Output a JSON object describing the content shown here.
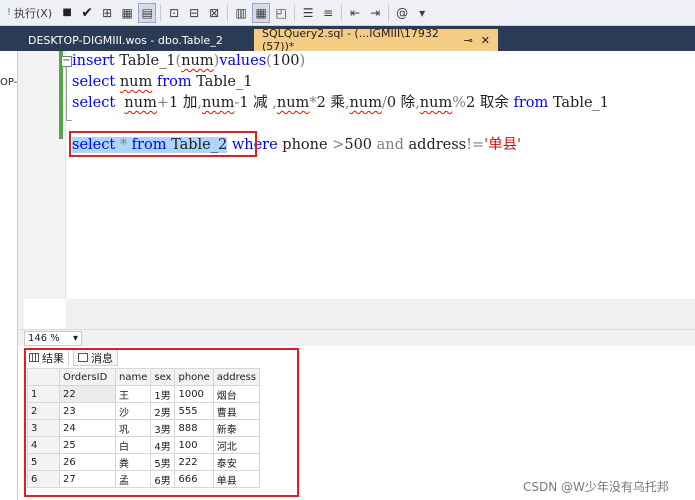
{
  "toolbar": {
    "execute_label": "执行(X)",
    "icons": [
      "dropdown-icon",
      "stop-icon",
      "check-icon",
      "plan-icon",
      "parse-icon",
      "results-to-icon",
      "comment-icon",
      "uncomment-icon",
      "indent-icon",
      "outdent-icon",
      "snippet-icon",
      "more-icon"
    ]
  },
  "tabs": {
    "inactive": "DESKTOP-DIGMIII.wos - dbo.Table_2",
    "active": "SQLQuery2.sql - (...IGMIII\\17932 (57))*",
    "pin": "⊸",
    "close": "✕",
    "left_close": "✕"
  },
  "left_panel": {
    "fragment": "OP-"
  },
  "editor": {
    "lines": [
      {
        "tokens": [
          {
            "t": "insert ",
            "c": "kw"
          },
          {
            "t": "Table_1",
            "c": "plain"
          },
          {
            "t": "(",
            "c": "gray"
          },
          {
            "t": "num",
            "c": "squig"
          },
          {
            "t": ")",
            "c": "gray"
          },
          {
            "t": "values",
            "c": "kw"
          },
          {
            "t": "(",
            "c": "gray"
          },
          {
            "t": "100",
            "c": "plain"
          },
          {
            "t": ")",
            "c": "gray"
          }
        ]
      },
      {
        "tokens": [
          {
            "t": "select ",
            "c": "kw"
          },
          {
            "t": "num",
            "c": "squig"
          },
          {
            "t": " ",
            "c": "plain"
          },
          {
            "t": "from ",
            "c": "kw"
          },
          {
            "t": "Table_1",
            "c": "plain"
          }
        ]
      },
      {
        "tokens": [
          {
            "t": "select  ",
            "c": "kw"
          },
          {
            "t": "num",
            "c": "squig"
          },
          {
            "t": "+",
            "c": "gray"
          },
          {
            "t": "1 加",
            "c": "plain"
          },
          {
            "t": ",",
            "c": "gray"
          },
          {
            "t": "num",
            "c": "squig"
          },
          {
            "t": "-",
            "c": "gray"
          },
          {
            "t": "1 减 ",
            "c": "plain"
          },
          {
            "t": ",",
            "c": "gray"
          },
          {
            "t": "num",
            "c": "squig"
          },
          {
            "t": "*",
            "c": "gray"
          },
          {
            "t": "2 乘",
            "c": "plain"
          },
          {
            "t": ",",
            "c": "gray"
          },
          {
            "t": "num",
            "c": "squig"
          },
          {
            "t": "/",
            "c": "gray"
          },
          {
            "t": "0 除",
            "c": "plain"
          },
          {
            "t": ",",
            "c": "gray"
          },
          {
            "t": "num",
            "c": "squig"
          },
          {
            "t": "%",
            "c": "gray"
          },
          {
            "t": "2 取余 ",
            "c": "plain"
          },
          {
            "t": "from ",
            "c": "kw"
          },
          {
            "t": "Table_1",
            "c": "plain"
          }
        ]
      },
      {
        "tokens": []
      },
      {
        "tokens": [
          {
            "t": "select ",
            "c": "kw sel"
          },
          {
            "t": "* ",
            "c": "gray sel"
          },
          {
            "t": "from ",
            "c": "kw sel"
          },
          {
            "t": "Table_2",
            "c": "plain sel"
          },
          {
            "t": " ",
            "c": "plain"
          },
          {
            "t": "where ",
            "c": "kw"
          },
          {
            "t": "phone ",
            "c": "plain"
          },
          {
            "t": ">",
            "c": "gray"
          },
          {
            "t": "500 ",
            "c": "plain"
          },
          {
            "t": "and ",
            "c": "gray"
          },
          {
            "t": "address",
            "c": "plain"
          },
          {
            "t": "!=",
            "c": "gray"
          },
          {
            "t": "'单县'",
            "c": "str"
          }
        ]
      }
    ]
  },
  "zoom": {
    "value": "146 %",
    "arrow": "▾"
  },
  "results": {
    "tab_results": "结果",
    "tab_messages": "消息",
    "columns": [
      "",
      "OrdersID",
      "name",
      "sex",
      "phone",
      "address"
    ],
    "rows": [
      [
        "1",
        "22",
        "王",
        "1男",
        "1000",
        "烟台"
      ],
      [
        "2",
        "23",
        "沙",
        "2男",
        "555",
        "曹县"
      ],
      [
        "3",
        "24",
        "巩",
        "3男",
        "888",
        "新泰"
      ],
      [
        "4",
        "25",
        "白",
        "4男",
        "100",
        "河北"
      ],
      [
        "5",
        "26",
        "粪",
        "5男",
        "222",
        "泰安"
      ],
      [
        "6",
        "27",
        "孟",
        "6男",
        "666",
        "单县"
      ]
    ]
  },
  "watermark": "CSDN @W少年没有乌托邦"
}
